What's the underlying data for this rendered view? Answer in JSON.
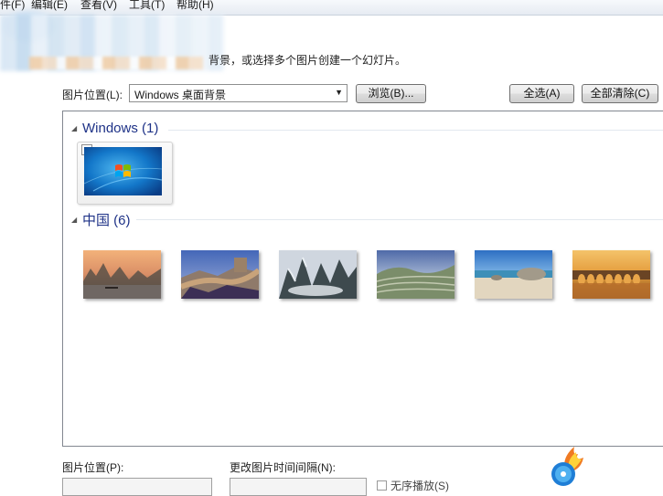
{
  "menu": {
    "items": [
      "件(F)",
      "编辑(E)",
      "查看(V)",
      "工具(T)",
      "帮助(H)"
    ]
  },
  "instructions": {
    "text": "背景，或选择多个图片创建一个幻灯片。"
  },
  "location_row": {
    "label": "图片位置(L):",
    "selected": "Windows 桌面背景",
    "browse": "浏览(B)...",
    "select_all": "全选(A)",
    "clear_all": "全部清除(C)"
  },
  "groups": [
    {
      "title": "Windows (1)",
      "thumbnails": [
        "windows-7-default"
      ],
      "checked": true
    },
    {
      "title": "中国 (6)",
      "thumbnails": [
        "karst-river",
        "great-wall",
        "mountain-peaks",
        "terraced-fields",
        "beach-rocks",
        "seventeen-arch-bridge"
      ]
    }
  ],
  "bottom": {
    "position_label": "图片位置(P):",
    "interval_label": "更改图片时间间隔(N):",
    "shuffle_label": "无序播放(S)"
  },
  "colors": {
    "group_title": "#1e3287"
  },
  "icons": {
    "collapse": "triangle-collapse-icon",
    "checkbox": "checkbox-checked-icon",
    "watermark": "flame-disc-logo"
  }
}
